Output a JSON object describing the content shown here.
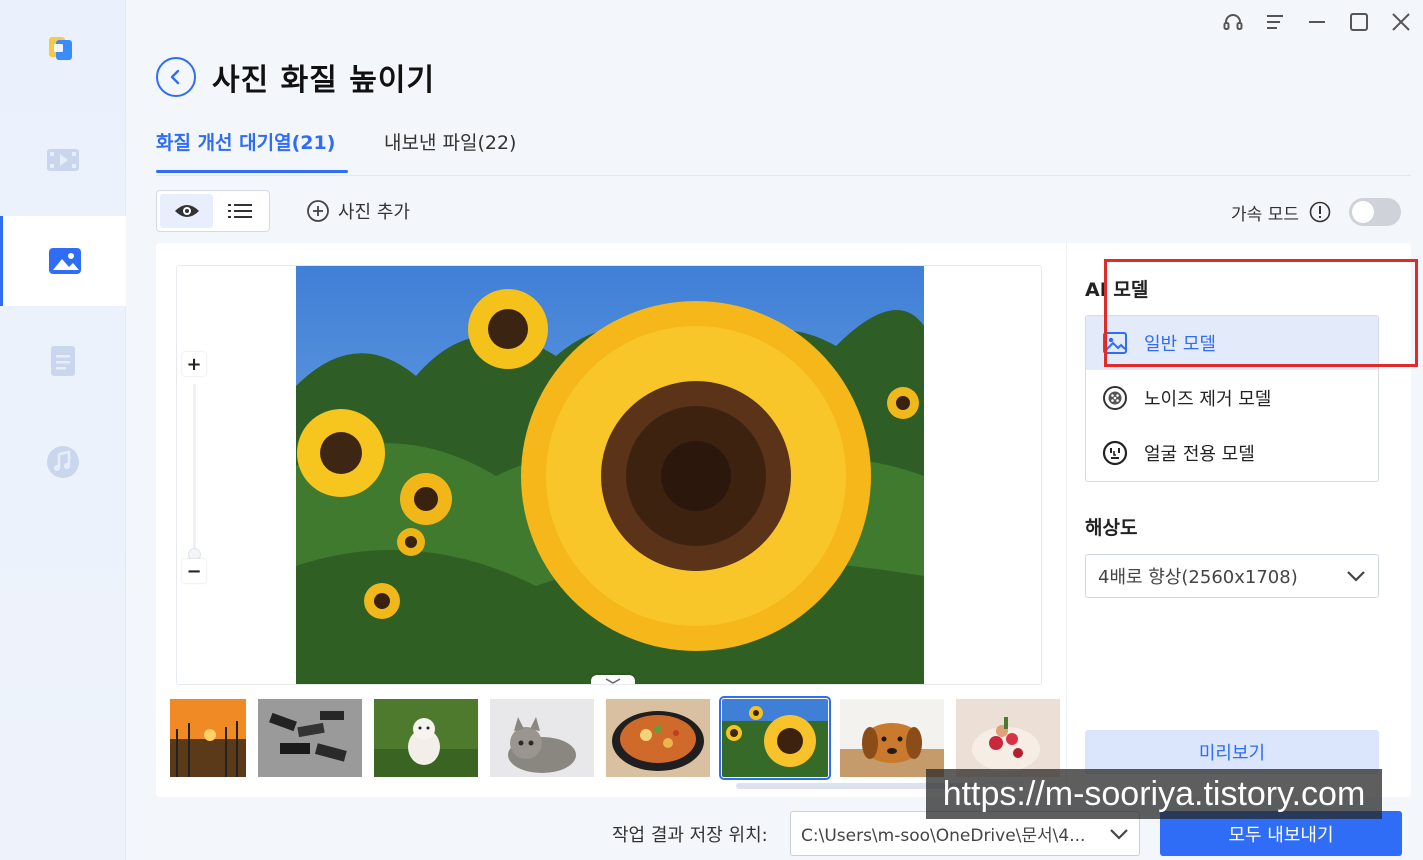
{
  "window": {
    "controls": [
      "headset-icon",
      "menu-icon",
      "minimize-icon",
      "maximize-icon",
      "close-icon"
    ]
  },
  "sidebar": {
    "items": [
      "video-icon",
      "photo-icon",
      "document-icon",
      "music-icon"
    ],
    "active": "photo-icon"
  },
  "header": {
    "title": "사진 화질 높이기"
  },
  "tabs": [
    {
      "label": "화질 개선 대기열(21)",
      "active": true
    },
    {
      "label": "내보낸 파일(22)",
      "active": false
    }
  ],
  "toolbar": {
    "add_photo": "사진 추가",
    "accel_mode": "가속 모드",
    "accel_enabled": false
  },
  "ai_panel": {
    "heading": "AI 모델",
    "models": [
      {
        "label": "일반 모델",
        "icon": "image-icon",
        "selected": true
      },
      {
        "label": "노이즈 제거 모델",
        "icon": "noise-icon",
        "selected": false
      },
      {
        "label": "얼굴 전용 모델",
        "icon": "face-icon",
        "selected": false
      }
    ],
    "resolution_heading": "해상도",
    "resolution_value": "4배로 향상(2560x1708)",
    "preview_button": "미리보기"
  },
  "thumbnails": [
    "sunset-lake",
    "usb-drives",
    "white-puppy",
    "kitten",
    "fried-rice",
    "sunflowers",
    "golden-puppy",
    "dessert"
  ],
  "selected_thumbnail": 5,
  "bottom": {
    "save_label": "작업 결과 저장 위치:",
    "save_path": "C:\\Users\\m-soo\\OneDrive\\문서\\4...",
    "export_all": "모두 내보내기"
  },
  "watermark": "https://m-sooriya.tistory.com",
  "colors": {
    "accent": "#2f6df6",
    "highlight": "#e02b2b"
  }
}
